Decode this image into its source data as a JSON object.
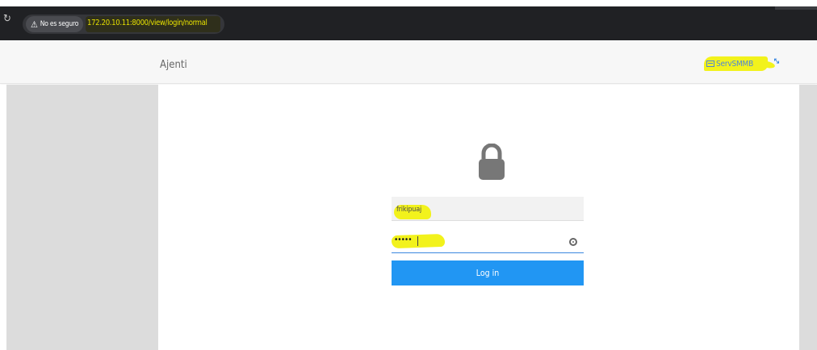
{
  "browser": {
    "security_label": "No es seguro",
    "url": "172.20.10.11:8000/view/login/normal"
  },
  "app": {
    "title": "Ajenti",
    "server_name": "ServSMMB"
  },
  "login": {
    "username": "frikipuaj",
    "password_mask": "•••••",
    "submit_label": "Log in"
  },
  "icons": {
    "reload": "reload-icon",
    "warning": "warning-icon",
    "server": "server-icon",
    "expand": "expand-icon",
    "lock": "lock-icon",
    "reveal_password": "eye-icon"
  },
  "colors": {
    "primary": "#2196f3",
    "link": "#4f86d9",
    "highlight": "#f2f21c",
    "chrome_bar": "#202124"
  }
}
